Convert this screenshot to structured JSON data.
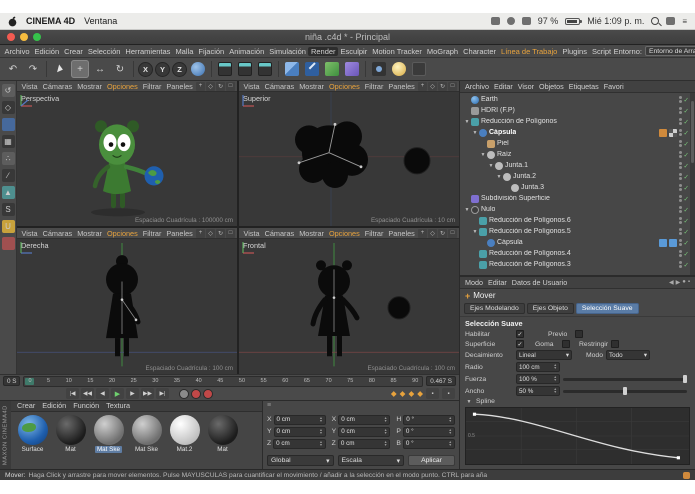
{
  "colors": {
    "viewport_menu_highlight": "#e8a33d",
    "selected_tab": "#5a7ca6",
    "check_green": "#7bc77b",
    "ui_gray": "#474747"
  },
  "macos": {
    "app_name": "CINEMA 4D",
    "menu_item": "Ventana",
    "battery_pct": "97 %",
    "clock": "Mié 1:09 p. m."
  },
  "window_title": "niña .c4d * - Principal",
  "menu": {
    "items": [
      "Archivo",
      "Edición",
      "Crear",
      "Selección",
      "Herramientas",
      "Malla",
      "Fijación",
      "Animación",
      "Simulación",
      "Render",
      "Esculpir",
      "Motion Tracker",
      "MoGraph",
      "Character",
      "Línea de Trabajo",
      "Plugins",
      "Script"
    ],
    "entorno_label": "Entorno:",
    "entorno_value": "Entorno de Arranque"
  },
  "toolbar": {
    "axis": [
      "X",
      "Y",
      "Z"
    ]
  },
  "viewport_menu": [
    "Vista",
    "Cámaras",
    "Mostrar",
    "Opciones",
    "Filtrar",
    "Paneles"
  ],
  "viewports": {
    "perspectiva": {
      "label": "Perspectiva",
      "grid": "Espaciado Cuadrícula : 100000 cm"
    },
    "superior": {
      "label": "Superior",
      "grid": "Espaciado Cuadrícula : 10 cm"
    },
    "derecha": {
      "label": "Derecha",
      "grid": "Espaciado Cuadrícula : 100 cm"
    },
    "frontal": {
      "label": "Frontal",
      "grid": "Espaciado Cuadrícula : 100 cm"
    }
  },
  "object_manager": {
    "menu": [
      "Archivo",
      "Editar",
      "Visor",
      "Objetos",
      "Etiquetas",
      "Favori"
    ],
    "tree": [
      {
        "label": "Earth"
      },
      {
        "label": "HDRI (F.P)"
      },
      {
        "label": "Reducción de Polígonos"
      },
      {
        "label": "Cápsula"
      },
      {
        "label": "Piel"
      },
      {
        "label": "Raíz"
      },
      {
        "label": "Junta.1"
      },
      {
        "label": "Junta.2"
      },
      {
        "label": "Junta.3"
      },
      {
        "label": "Subdivisión Superficie"
      },
      {
        "label": "Nulo"
      },
      {
        "label": "Reducción de Polígonos.6"
      },
      {
        "label": "Reducción de Polígonos.5"
      },
      {
        "label": "Cápsula"
      },
      {
        "label": "Reducción de Polígonos.4"
      },
      {
        "label": "Reducción de Polígonos.3"
      }
    ]
  },
  "attributes": {
    "menu": [
      "Modo",
      "Editar",
      "Datos de Usuario"
    ],
    "tool_name": "Mover",
    "tabs": [
      "Ejes Modelando",
      "Ejes Objeto",
      "Selección Suave"
    ],
    "section_title": "Selección Suave",
    "habilitar": "Habilitar",
    "previo": "Previo",
    "superficie": "Superficie",
    "goma": "Goma",
    "restringir": "Restringir",
    "decaimiento_label": "Decaimiento",
    "decaimiento_value": "Lineal",
    "modo_label": "Modo",
    "modo_value": "Todo",
    "radio_label": "Radio",
    "radio_value": "100 cm",
    "fuerza_label": "Fuerza",
    "fuerza_value": "100 %",
    "ancho_label": "Ancho",
    "ancho_value": "50 %",
    "spline_label": "Spline",
    "graph_tick": "0.5"
  },
  "timeline": {
    "start": "0 S",
    "current": "0.467 S",
    "ticks": [
      "0",
      "5",
      "10",
      "15",
      "20",
      "25",
      "30",
      "35",
      "40",
      "45",
      "50",
      "55",
      "60",
      "65",
      "70",
      "75",
      "80",
      "85",
      "90"
    ]
  },
  "materials": {
    "menu": [
      "Crear",
      "Edición",
      "Función",
      "Textura"
    ],
    "items": [
      {
        "label": "Surface"
      },
      {
        "label": "Mat"
      },
      {
        "label": "Mat Ske"
      },
      {
        "label": "Mat Ske"
      },
      {
        "label": "Mat.2"
      },
      {
        "label": "Mat"
      }
    ],
    "brand_top": "MAXON",
    "brand_bottom": "CINEMA4D"
  },
  "coordinates": {
    "pos": [
      {
        "axis": "X",
        "value": "0 cm"
      },
      {
        "axis": "Y",
        "value": "0 cm"
      },
      {
        "axis": "Z",
        "value": "0 cm"
      }
    ],
    "size": [
      {
        "axis": "X",
        "value": "0 cm"
      },
      {
        "axis": "Y",
        "value": "0 cm"
      },
      {
        "axis": "Z",
        "value": "0 cm"
      }
    ],
    "rot": [
      {
        "axis": "H",
        "value": "0 °"
      },
      {
        "axis": "P",
        "value": "0 °"
      },
      {
        "axis": "B",
        "value": "0 °"
      }
    ],
    "dropdown_left": "Global",
    "dropdown_mid": "Escala",
    "apply_label": "Aplicar"
  },
  "statusbar": {
    "prefix": "Mover:",
    "text": "Haga Click y arrastre para mover elementos. Pulse MAYUSCULAS para cuantificar el movimiento / añadir a la selección en el modo punto. CTRL para aña"
  }
}
